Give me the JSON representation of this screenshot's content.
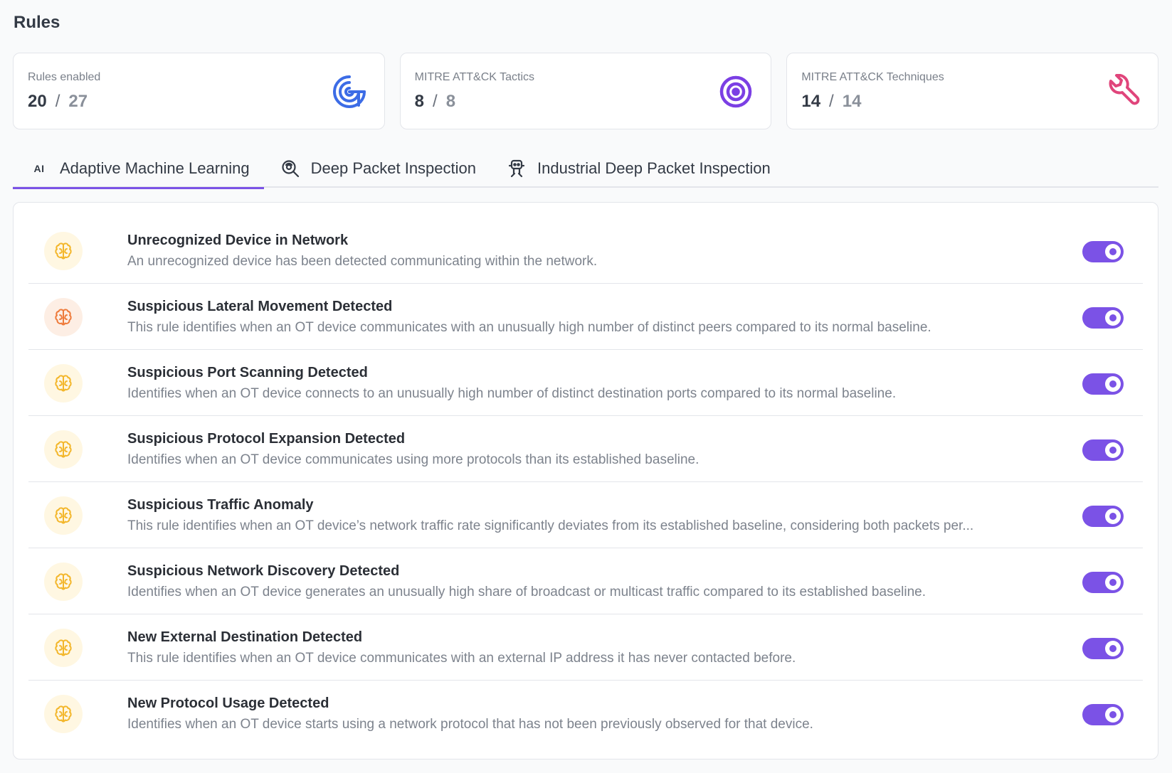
{
  "page": {
    "title": "Rules"
  },
  "stats": [
    {
      "label": "Rules enabled",
      "value": "20",
      "total": "27",
      "icon": "radar-icon",
      "color": "#3c6ce6"
    },
    {
      "label": "MITRE ATT&CK Tactics",
      "value": "8",
      "total": "8",
      "icon": "target-icon",
      "color": "#7b3fe4"
    },
    {
      "label": "MITRE ATT&CK Techniques",
      "value": "14",
      "total": "14",
      "icon": "wrench-icon",
      "color": "#e0457b"
    }
  ],
  "stat_separator": "/",
  "tabs": [
    {
      "label": "Adaptive Machine Learning",
      "icon": "ai-icon",
      "icon_text": "AI",
      "active": true
    },
    {
      "label": "Deep Packet Inspection",
      "icon": "magnify-scan-icon",
      "active": false
    },
    {
      "label": "Industrial Deep Packet Inspection",
      "icon": "robot-icon",
      "active": false
    }
  ],
  "rules": [
    {
      "title": "Unrecognized Device in Network",
      "description": "An unrecognized device has been detected communicating within the network.",
      "icon": "brain-icon",
      "icon_color": "#f3b62a",
      "enabled": true
    },
    {
      "title": "Suspicious Lateral Movement Detected",
      "description": "This rule identifies when an OT device communicates with an unusually high number of distinct peers compared to its normal baseline.",
      "icon": "brain-icon",
      "icon_color": "#ee7a3a",
      "enabled": true
    },
    {
      "title": "Suspicious Port Scanning Detected",
      "description": "Identifies when an OT device connects to an unusually high number of distinct destination ports compared to its normal baseline.",
      "icon": "brain-icon",
      "icon_color": "#f3b62a",
      "enabled": true
    },
    {
      "title": "Suspicious Protocol Expansion Detected",
      "description": "Identifies when an OT device communicates using more protocols than its established baseline.",
      "icon": "brain-icon",
      "icon_color": "#f3b62a",
      "enabled": true
    },
    {
      "title": "Suspicious Traffic Anomaly",
      "description": "This rule identifies when an OT device’s network traffic rate significantly deviates from its established baseline, considering both packets per...",
      "icon": "brain-icon",
      "icon_color": "#f3b62a",
      "enabled": true
    },
    {
      "title": "Suspicious Network Discovery Detected",
      "description": "Identifies when an OT device generates an unusually high share of broadcast or multicast traffic compared to its established baseline.",
      "icon": "brain-icon",
      "icon_color": "#f3b62a",
      "enabled": true
    },
    {
      "title": "New External Destination Detected",
      "description": "This rule identifies when an OT device communicates with an external IP address it has never contacted before.",
      "icon": "brain-icon",
      "icon_color": "#f3b62a",
      "enabled": true
    },
    {
      "title": "New Protocol Usage Detected",
      "description": "Identifies when an OT device starts using a network protocol that has not been previously observed for that device.",
      "icon": "brain-icon",
      "icon_color": "#f3b62a",
      "enabled": true
    }
  ],
  "colors": {
    "accent": "#7b52e6"
  }
}
